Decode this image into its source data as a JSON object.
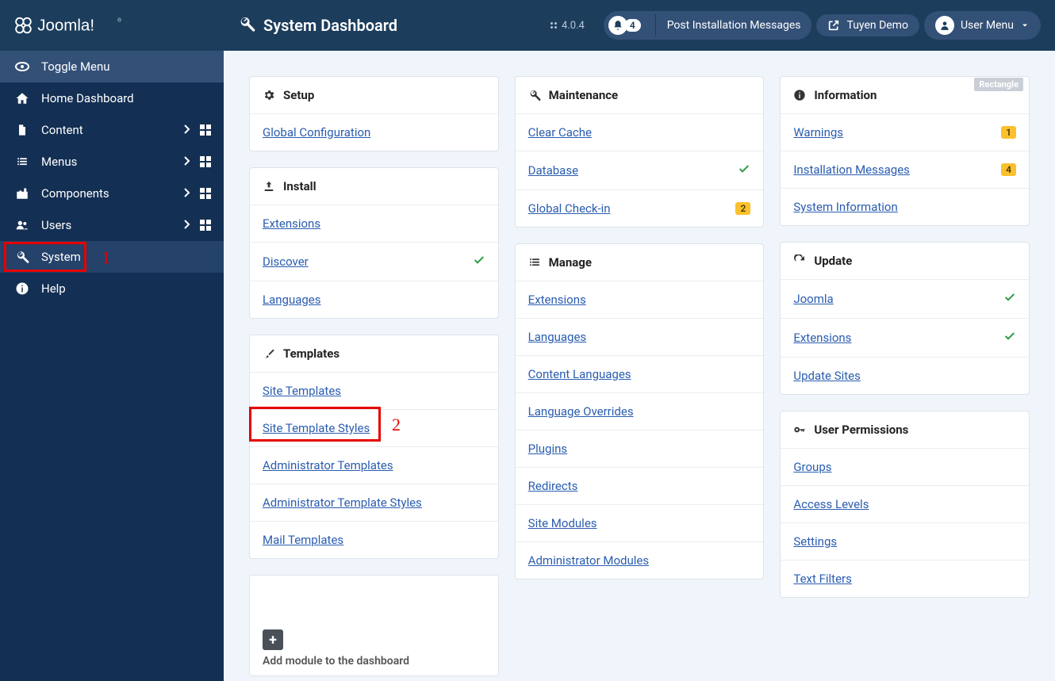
{
  "brand": "Joomla!",
  "page_title": "System Dashboard",
  "version": "4.0.4",
  "topbar": {
    "notifications_count": "4",
    "notifications_label": "Post Installation Messages",
    "site_name": "Tuyen Demo",
    "user_menu": "User Menu"
  },
  "sidebar": {
    "toggle": "Toggle Menu",
    "items": [
      {
        "label": "Home Dashboard",
        "icon": "home",
        "has_sub": false
      },
      {
        "label": "Content",
        "icon": "file",
        "has_sub": true
      },
      {
        "label": "Menus",
        "icon": "list",
        "has_sub": true
      },
      {
        "label": "Components",
        "icon": "puzzle",
        "has_sub": true
      },
      {
        "label": "Users",
        "icon": "users",
        "has_sub": true
      },
      {
        "label": "System",
        "icon": "wrench",
        "has_sub": false,
        "active": true
      },
      {
        "label": "Help",
        "icon": "info",
        "has_sub": false
      }
    ]
  },
  "annotations": {
    "one": "1",
    "two": "2"
  },
  "cards": {
    "setup": {
      "title": "Setup",
      "links": [
        {
          "label": "Global Configuration"
        }
      ]
    },
    "install": {
      "title": "Install",
      "links": [
        {
          "label": "Extensions"
        },
        {
          "label": "Discover",
          "check": true
        },
        {
          "label": "Languages"
        }
      ]
    },
    "templates": {
      "title": "Templates",
      "links": [
        {
          "label": "Site Templates"
        },
        {
          "label": "Site Template Styles"
        },
        {
          "label": "Administrator Templates"
        },
        {
          "label": "Administrator Template Styles"
        },
        {
          "label": "Mail Templates"
        }
      ]
    },
    "maintenance": {
      "title": "Maintenance",
      "links": [
        {
          "label": "Clear Cache"
        },
        {
          "label": "Database",
          "check": true
        },
        {
          "label": "Global Check-in",
          "badge": "2"
        }
      ]
    },
    "manage": {
      "title": "Manage",
      "links": [
        {
          "label": "Extensions"
        },
        {
          "label": "Languages"
        },
        {
          "label": "Content Languages"
        },
        {
          "label": "Language Overrides"
        },
        {
          "label": "Plugins"
        },
        {
          "label": "Redirects"
        },
        {
          "label": "Site Modules"
        },
        {
          "label": "Administrator Modules"
        }
      ]
    },
    "information": {
      "title": "Information",
      "links": [
        {
          "label": "Warnings",
          "badge": "1"
        },
        {
          "label": "Installation Messages",
          "badge": "4"
        },
        {
          "label": "System Information"
        }
      ]
    },
    "update": {
      "title": "Update",
      "links": [
        {
          "label": "Joomla",
          "check": true
        },
        {
          "label": "Extensions",
          "check": true
        },
        {
          "label": "Update Sites"
        }
      ]
    },
    "permissions": {
      "title": "User Permissions",
      "rect": "Rectangle",
      "links": [
        {
          "label": "Groups"
        },
        {
          "label": "Access Levels"
        },
        {
          "label": "Settings"
        },
        {
          "label": "Text Filters"
        }
      ]
    }
  },
  "add_module": "Add module to the dashboard"
}
